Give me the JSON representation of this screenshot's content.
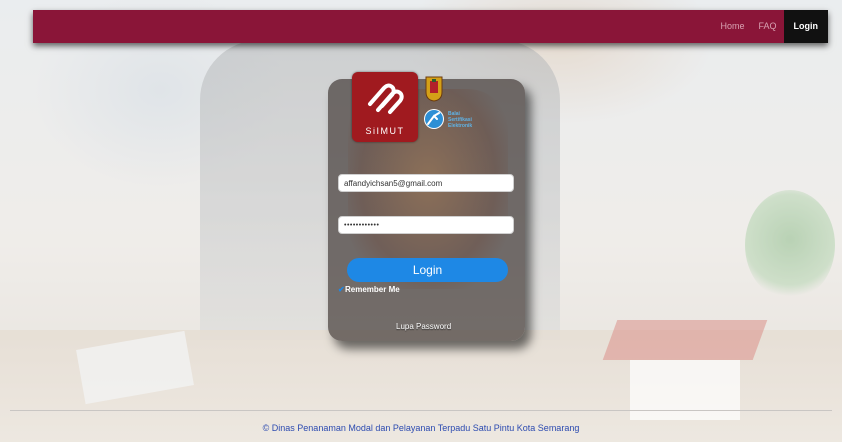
{
  "nav": {
    "links": [
      {
        "label": "Home"
      },
      {
        "label": "FAQ"
      },
      {
        "label": "Login"
      }
    ]
  },
  "logos": {
    "siimut_word": "SiIMUT",
    "bse_text": [
      "Balai",
      "Sertifikasi",
      "Elektronik"
    ]
  },
  "login_form": {
    "email_value": "affandyichsan5@gmail.com",
    "password_value": "••••••••••••",
    "login_button": "Login",
    "remember_label": "Remember Me",
    "remember_checked": true,
    "forgot_link": "Lupa Password"
  },
  "footer": {
    "text": "© Dinas Penanaman Modal dan Pelayanan Terpadu Satu Pintu Kota Semarang"
  },
  "colors": {
    "navbar": "#8a1538",
    "accent": "#1e88e5",
    "logo_red": "#a01a1f"
  }
}
